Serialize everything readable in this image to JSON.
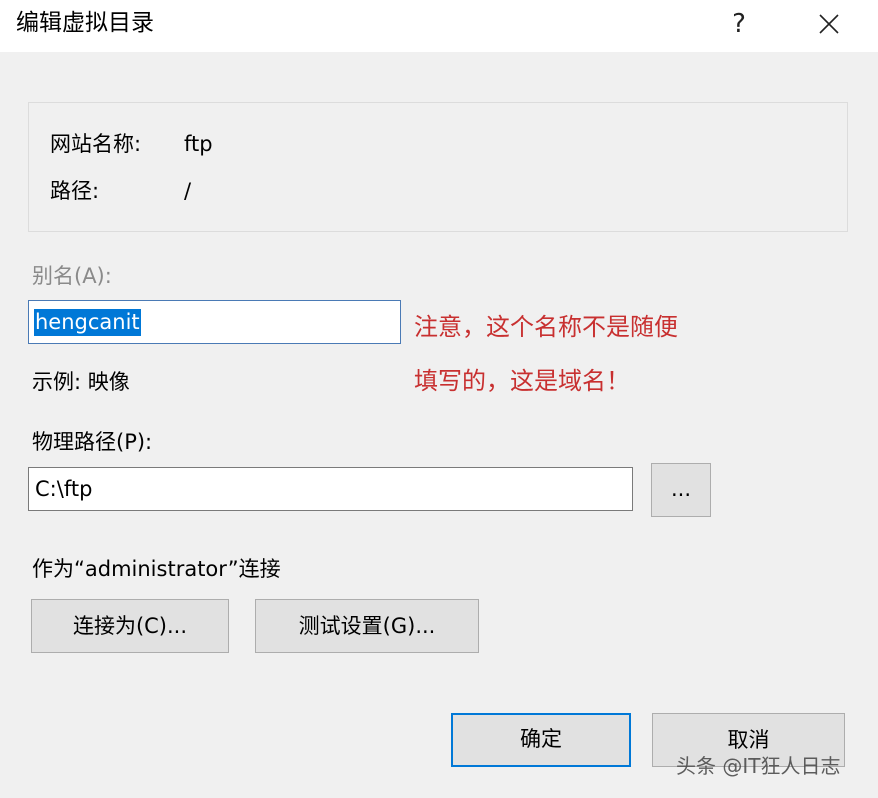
{
  "window": {
    "title": "编辑虚拟目录",
    "help_label": "?"
  },
  "info": {
    "site_name_label": "网站名称:",
    "site_name_value": "ftp",
    "path_label": "路径:",
    "path_value": "/"
  },
  "alias": {
    "label": "别名(A):",
    "value": "hengcanit",
    "example": "示例: 映像"
  },
  "annotation": {
    "line1": "注意，这个名称不是随便",
    "line2": "填写的，这是域名！"
  },
  "physical_path": {
    "label": "物理路径(P):",
    "value": "C:\\ftp",
    "browse_label": "..."
  },
  "connect": {
    "status_text": "作为“administrator”连接",
    "connect_as_label": "连接为(C)...",
    "test_settings_label": "测试设置(G)..."
  },
  "footer": {
    "ok_label": "确定",
    "cancel_label": "取消"
  },
  "watermark": "头条 @IT狂人日志",
  "colors": {
    "selection": "#0078d7",
    "annotation": "#c83030",
    "default_button_border": "#0078d7"
  }
}
